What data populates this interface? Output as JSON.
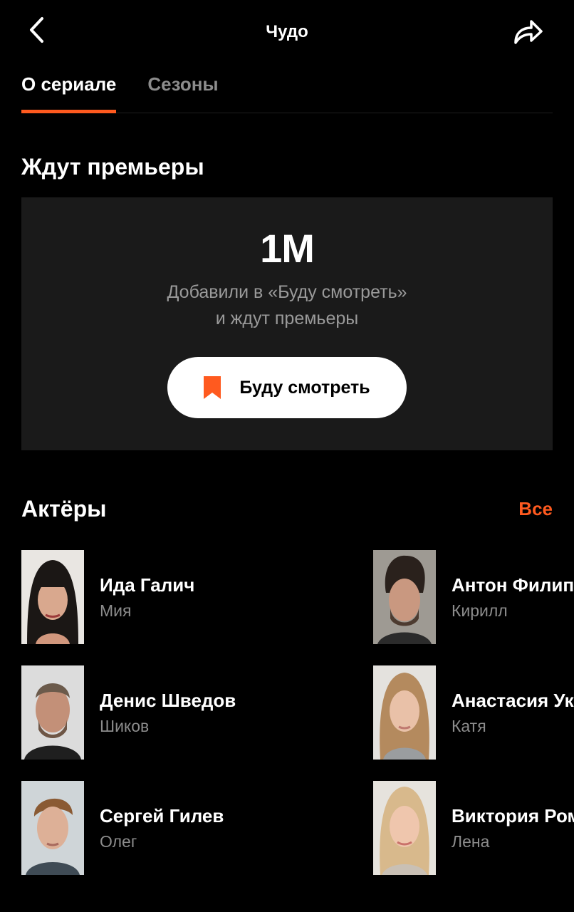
{
  "header": {
    "title": "Чудо",
    "back_icon": "chevron-left-icon",
    "share_icon": "share-icon"
  },
  "tabs": [
    {
      "label": "О сериале",
      "active": true
    },
    {
      "label": "Сезоны",
      "active": false
    }
  ],
  "premiere": {
    "section_title": "Ждут премьеры",
    "count": "1M",
    "desc_line1": "Добавили в «Буду смотреть»",
    "desc_line2": "и ждут премьеры",
    "button_label": "Буду смотреть",
    "button_icon": "bookmark-icon"
  },
  "actors": {
    "section_title": "Актёры",
    "all_label": "Все",
    "items": [
      {
        "name": "Ида Галич",
        "role": "Мия"
      },
      {
        "name": "Антон Филиппенко",
        "role": "Кирилл"
      },
      {
        "name": "Денис Шведов",
        "role": "Шиков"
      },
      {
        "name": "Анастасия Уколова",
        "role": "Катя"
      },
      {
        "name": "Сергей Гилев",
        "role": "Олег"
      },
      {
        "name": "Виктория Романенко",
        "role": "Лена"
      }
    ]
  },
  "colors": {
    "background": "#000000",
    "card": "#1a1a1a",
    "accent": "#ff5a1f",
    "muted_text": "#8c8c8c",
    "button_bg": "#ffffff"
  }
}
